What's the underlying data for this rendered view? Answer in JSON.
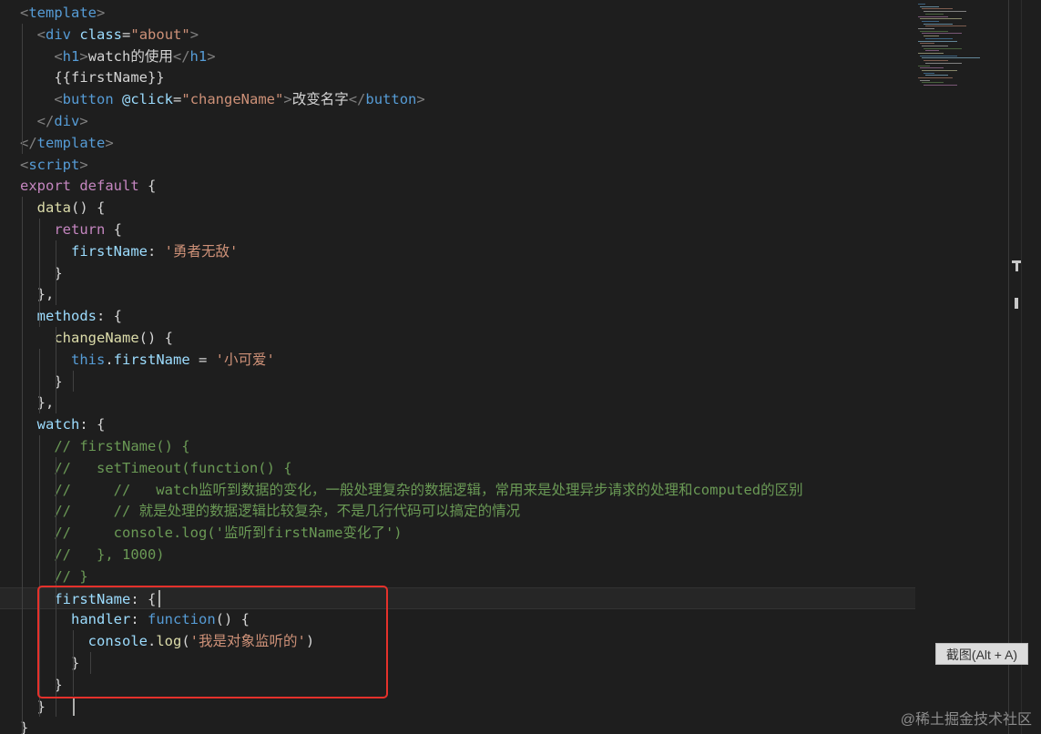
{
  "code_lines": [
    [
      {
        "c": "t-angle",
        "t": "<"
      },
      {
        "c": "t-tag",
        "t": "template"
      },
      {
        "c": "t-angle",
        "t": ">"
      }
    ],
    [
      {
        "c": "t-plain",
        "t": "  "
      },
      {
        "c": "t-angle",
        "t": "<"
      },
      {
        "c": "t-tag",
        "t": "div"
      },
      {
        "c": "t-plain",
        "t": " "
      },
      {
        "c": "t-attr",
        "t": "class"
      },
      {
        "c": "t-plain",
        "t": "="
      },
      {
        "c": "t-str",
        "t": "\"about\""
      },
      {
        "c": "t-angle",
        "t": ">"
      }
    ],
    [
      {
        "c": "t-plain",
        "t": "    "
      },
      {
        "c": "t-angle",
        "t": "<"
      },
      {
        "c": "t-tag",
        "t": "h1"
      },
      {
        "c": "t-angle",
        "t": ">"
      },
      {
        "c": "t-plain",
        "t": "watch的使用"
      },
      {
        "c": "t-angle",
        "t": "</"
      },
      {
        "c": "t-tag",
        "t": "h1"
      },
      {
        "c": "t-angle",
        "t": ">"
      }
    ],
    [
      {
        "c": "t-plain",
        "t": "    {{firstName}}"
      }
    ],
    [
      {
        "c": "t-plain",
        "t": "    "
      },
      {
        "c": "t-angle",
        "t": "<"
      },
      {
        "c": "t-tag",
        "t": "button"
      },
      {
        "c": "t-plain",
        "t": " "
      },
      {
        "c": "t-attr",
        "t": "@click"
      },
      {
        "c": "t-plain",
        "t": "="
      },
      {
        "c": "t-str",
        "t": "\"changeName\""
      },
      {
        "c": "t-angle",
        "t": ">"
      },
      {
        "c": "t-plain",
        "t": "改变名字"
      },
      {
        "c": "t-angle",
        "t": "</"
      },
      {
        "c": "t-tag",
        "t": "button"
      },
      {
        "c": "t-angle",
        "t": ">"
      }
    ],
    [
      {
        "c": "t-plain",
        "t": "  "
      },
      {
        "c": "t-angle",
        "t": "</"
      },
      {
        "c": "t-tag",
        "t": "div"
      },
      {
        "c": "t-angle",
        "t": ">"
      }
    ],
    [
      {
        "c": "t-angle",
        "t": "</"
      },
      {
        "c": "t-tag",
        "t": "template"
      },
      {
        "c": "t-angle",
        "t": ">"
      }
    ],
    [
      {
        "c": "t-angle",
        "t": "<"
      },
      {
        "c": "t-tag",
        "t": "script"
      },
      {
        "c": "t-angle",
        "t": ">"
      }
    ],
    [
      {
        "c": "t-ctrl",
        "t": "export"
      },
      {
        "c": "t-plain",
        "t": " "
      },
      {
        "c": "t-ctrl",
        "t": "default"
      },
      {
        "c": "t-plain",
        "t": " {"
      }
    ],
    [
      {
        "c": "t-plain",
        "t": "  "
      },
      {
        "c": "t-fn",
        "t": "data"
      },
      {
        "c": "t-plain",
        "t": "() {"
      }
    ],
    [
      {
        "c": "t-plain",
        "t": "    "
      },
      {
        "c": "t-ctrl",
        "t": "return"
      },
      {
        "c": "t-plain",
        "t": " {"
      }
    ],
    [
      {
        "c": "t-plain",
        "t": "      "
      },
      {
        "c": "t-prop",
        "t": "firstName"
      },
      {
        "c": "t-plain",
        "t": ": "
      },
      {
        "c": "t-str",
        "t": "'勇者无敌'"
      }
    ],
    [
      {
        "c": "t-plain",
        "t": "    }"
      }
    ],
    [
      {
        "c": "t-plain",
        "t": "  },"
      }
    ],
    [
      {
        "c": "t-plain",
        "t": "  "
      },
      {
        "c": "t-prop",
        "t": "methods"
      },
      {
        "c": "t-plain",
        "t": ": {"
      }
    ],
    [
      {
        "c": "t-plain",
        "t": "    "
      },
      {
        "c": "t-fn",
        "t": "changeName"
      },
      {
        "c": "t-plain",
        "t": "() {"
      }
    ],
    [
      {
        "c": "t-plain",
        "t": "      "
      },
      {
        "c": "t-kw",
        "t": "this"
      },
      {
        "c": "t-plain",
        "t": "."
      },
      {
        "c": "t-prop",
        "t": "firstName"
      },
      {
        "c": "t-plain",
        "t": " = "
      },
      {
        "c": "t-str",
        "t": "'小可爱'"
      }
    ],
    [
      {
        "c": "t-plain",
        "t": "    }"
      }
    ],
    [
      {
        "c": "t-plain",
        "t": "  },"
      }
    ],
    [
      {
        "c": "t-plain",
        "t": "  "
      },
      {
        "c": "t-prop",
        "t": "watch"
      },
      {
        "c": "t-plain",
        "t": ": {"
      }
    ],
    [
      {
        "c": "t-plain",
        "t": "    "
      },
      {
        "c": "t-cmt",
        "t": "// firstName() {"
      }
    ],
    [
      {
        "c": "t-plain",
        "t": "    "
      },
      {
        "c": "t-cmt",
        "t": "//   setTimeout(function() {"
      }
    ],
    [
      {
        "c": "t-plain",
        "t": "    "
      },
      {
        "c": "t-cmt",
        "t": "//     //   watch监听到数据的变化，一般处理复杂的数据逻辑，常用来是处理异步请求的处理和computed的区别"
      }
    ],
    [
      {
        "c": "t-plain",
        "t": "    "
      },
      {
        "c": "t-cmt",
        "t": "//     // 就是处理的数据逻辑比较复杂，不是几行代码可以搞定的情况"
      }
    ],
    [
      {
        "c": "t-plain",
        "t": "    "
      },
      {
        "c": "t-cmt",
        "t": "//     console.log('监听到firstName变化了')"
      }
    ],
    [
      {
        "c": "t-plain",
        "t": "    "
      },
      {
        "c": "t-cmt",
        "t": "//   }, 1000)"
      }
    ],
    [
      {
        "c": "t-plain",
        "t": "    "
      },
      {
        "c": "t-cmt",
        "t": "// }"
      }
    ],
    [
      {
        "c": "t-plain",
        "t": "    "
      },
      {
        "c": "t-prop",
        "t": "firstName"
      },
      {
        "c": "t-plain",
        "t": ": {"
      }
    ],
    [
      {
        "c": "t-plain",
        "t": "      "
      },
      {
        "c": "t-prop",
        "t": "handler"
      },
      {
        "c": "t-plain",
        "t": ": "
      },
      {
        "c": "t-kw",
        "t": "function"
      },
      {
        "c": "t-plain",
        "t": "() {"
      }
    ],
    [
      {
        "c": "t-plain",
        "t": "        "
      },
      {
        "c": "t-prop",
        "t": "console"
      },
      {
        "c": "t-plain",
        "t": "."
      },
      {
        "c": "t-fn",
        "t": "log"
      },
      {
        "c": "t-plain",
        "t": "("
      },
      {
        "c": "t-str",
        "t": "'我是对象监听的'"
      },
      {
        "c": "t-plain",
        "t": ")"
      }
    ],
    [
      {
        "c": "t-plain",
        "t": "      }"
      }
    ],
    [
      {
        "c": "t-plain",
        "t": "    }"
      }
    ],
    [
      {
        "c": "t-plain",
        "t": "  }"
      }
    ],
    [
      {
        "c": "t-plain",
        "t": "}"
      }
    ]
  ],
  "current_line": 27,
  "tooltip": "截图(Alt + A)",
  "watermark": "@稀土掘金技术社区",
  "colors": {
    "highlight_box": "#e5312b",
    "background": "#1e1e1e"
  }
}
